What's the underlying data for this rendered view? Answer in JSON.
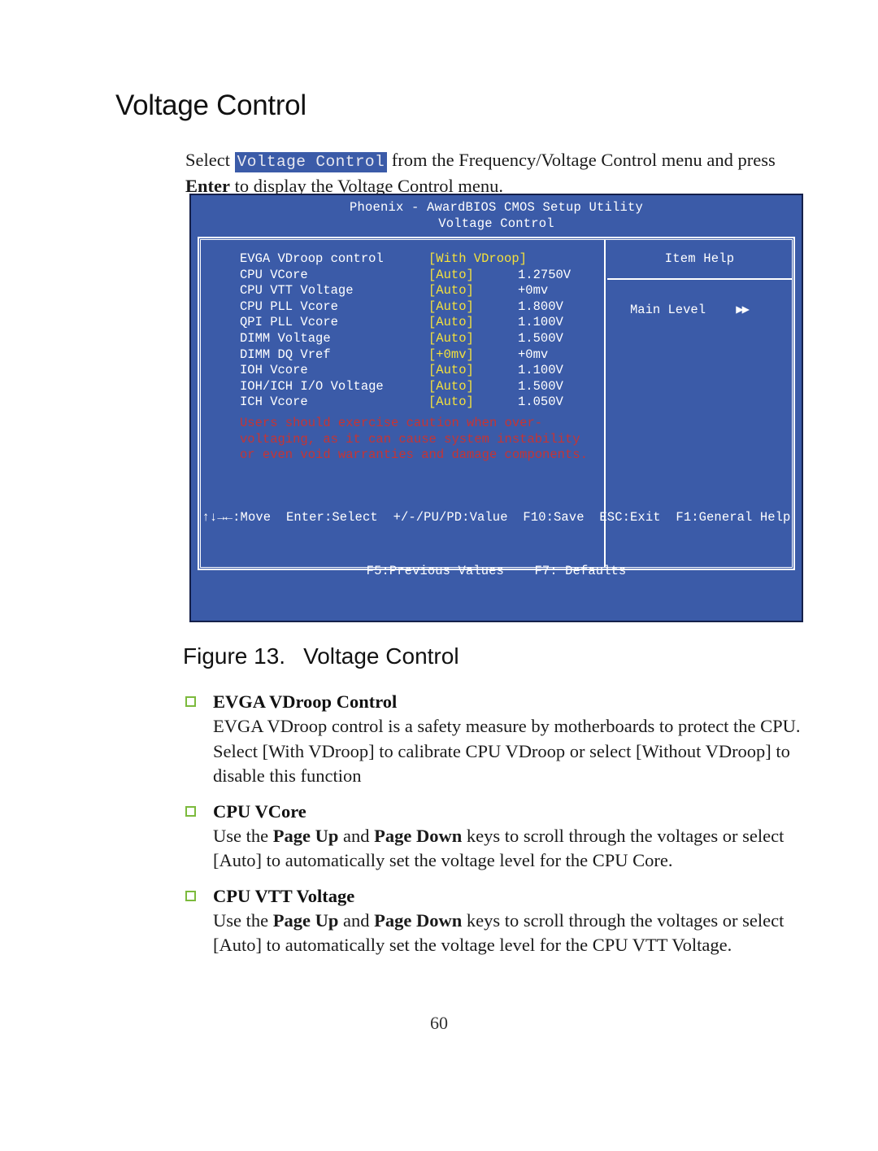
{
  "page": {
    "heading": "Voltage Control",
    "number": "60"
  },
  "intro": {
    "before": "Select ",
    "highlight": "Voltage Control",
    "middle": " from the Frequency/Voltage Control menu and press ",
    "bold_key": "Enter",
    "after": " to display the Voltage Control menu."
  },
  "bios": {
    "title": "Phoenix - AwardBIOS CMOS Setup Utility",
    "subtitle": "Voltage Control",
    "rows": [
      {
        "label": "EVGA VDroop control",
        "value": "[With VDroop]",
        "reading": ""
      },
      {
        "label": "CPU VCore",
        "value": "[Auto]",
        "reading": "1.2750V"
      },
      {
        "label": "CPU VTT Voltage",
        "value": "[Auto]",
        "reading": "+0mv"
      },
      {
        "label": "CPU PLL Vcore",
        "value": "[Auto]",
        "reading": "1.800V"
      },
      {
        "label": "QPI PLL Vcore",
        "value": "[Auto]",
        "reading": "1.100V"
      },
      {
        "label": "DIMM Voltage",
        "value": "[Auto]",
        "reading": "1.500V"
      },
      {
        "label": "DIMM DQ Vref",
        "value": "[+0mv]",
        "reading": "+0mv"
      },
      {
        "label": "IOH Vcore",
        "value": "[Auto]",
        "reading": "1.100V"
      },
      {
        "label": "IOH/ICH I/O Voltage",
        "value": "[Auto]",
        "reading": "1.500V"
      },
      {
        "label": "ICH Vcore",
        "value": "[Auto]",
        "reading": "1.050V"
      }
    ],
    "warning": "Users should exercise caution when over-\nvoltaging, as it can cause system instability\nor even void warranties and damage components.",
    "help_title": "Item Help",
    "help_level": "Main Level",
    "help_arrows": "▶▶",
    "footer_line1": "↑↓→←:Move  Enter:Select  +/-/PU/PD:Value  F10:Save  ESC:Exit  F1:General Help",
    "footer_line2": "F5:Previous Values    F7: Defaults",
    "colors": {
      "background": "#3b5ba8",
      "value_text": "#f4e13c",
      "warning_text": "#c63434",
      "border": "#ffffff"
    }
  },
  "figure": {
    "label": "Figure 13.",
    "title": "Voltage Control"
  },
  "sections": [
    {
      "heading": "EVGA VDroop Control",
      "body": "EVGA VDroop control is a safety measure by motherboards to protect the CPU. Select [With VDroop] to calibrate CPU VDroop or select [Without VDroop] to disable this function"
    },
    {
      "heading": "CPU VCore",
      "body_parts": {
        "p1": "Use the ",
        "b1": "Page Up",
        "p2": " and ",
        "b2": "Page Down",
        "p3": " keys to scroll through the voltages or select [Auto] to automatically set the voltage level for the CPU Core."
      }
    },
    {
      "heading": "CPU VTT Voltage",
      "body_parts": {
        "p1": "Use the ",
        "b1": "Page Up",
        "p2": " and ",
        "b2": "Page Down",
        "p3": " keys to scroll through the voltages or select [Auto] to automatically set the voltage level for the CPU VTT Voltage."
      }
    }
  ]
}
